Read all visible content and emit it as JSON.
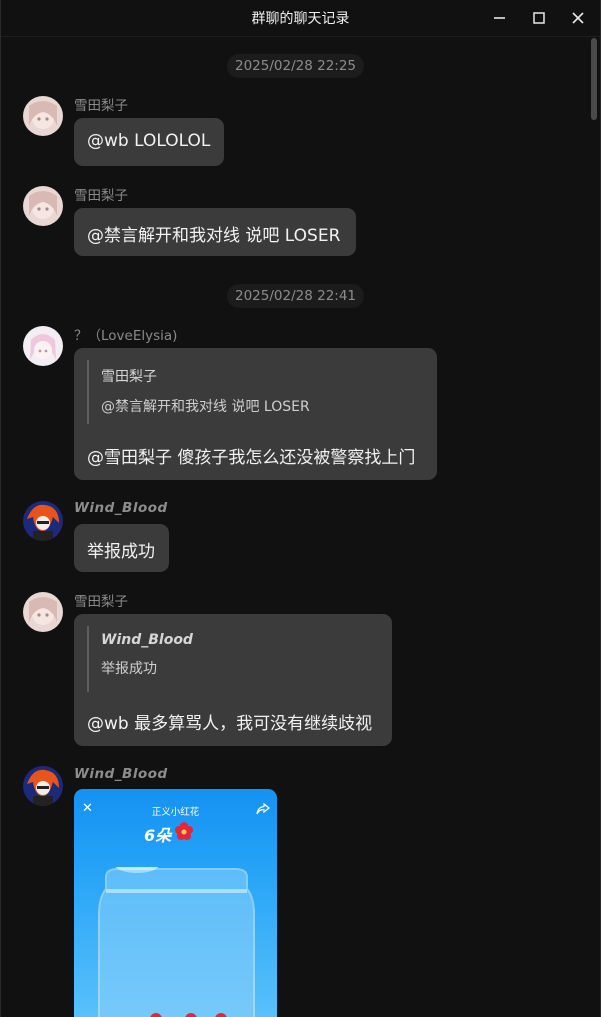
{
  "window": {
    "title": "群聊的聊天记录",
    "controls": [
      "minimize-icon",
      "maximize-icon",
      "close-icon"
    ]
  },
  "messages": [
    {
      "timestamp": "2025/02/28 22:25"
    },
    {
      "sender": "雪田梨子",
      "text": "@wb LOLOLOL"
    },
    {
      "sender": "雪田梨子",
      "text": "@禁言解开和我对线 说吧 LOSER"
    },
    {
      "timestamp": "2025/02/28 22:41"
    },
    {
      "sender": "？（LoveElysia)",
      "quote": {
        "name": "雪田梨子",
        "text": "@禁言解开和我对线 说吧 LOSER"
      },
      "text": "@雪田梨子 傻孩子我怎么还没被警察找上门"
    },
    {
      "sender": "Wind_Blood",
      "text": "举报成功"
    },
    {
      "sender": "雪田梨子",
      "quote": {
        "name": "Wind_Blood",
        "text": "举报成功"
      },
      "text": "@wb 最多算骂人，我可没有继续歧视"
    },
    {
      "sender": "Wind_Blood",
      "image": {
        "title": "正义小红花",
        "count": "6朵"
      }
    }
  ],
  "colors": {
    "background": "#111111",
    "bubble": "#3b3b3b",
    "timestamp_bg": "#1c1c1c",
    "flower_red": "#e8233a",
    "image_blue": "#1591f2"
  }
}
